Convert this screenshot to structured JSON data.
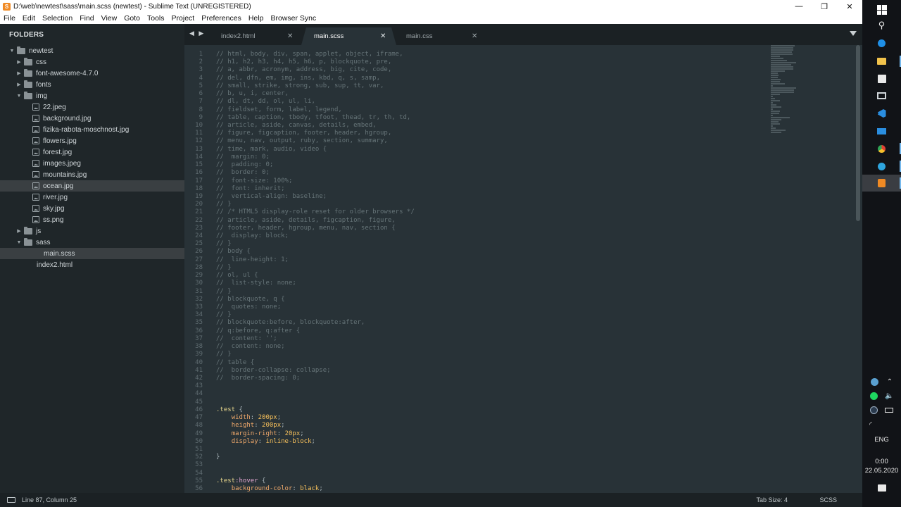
{
  "window": {
    "title": "D:\\web\\newtest\\sass\\main.scss (newtest) - Sublime Text (UNREGISTERED)",
    "minimize_glyph": "—",
    "restore_glyph": "❐",
    "close_glyph": "✕"
  },
  "menu": [
    "File",
    "Edit",
    "Selection",
    "Find",
    "View",
    "Goto",
    "Tools",
    "Project",
    "Preferences",
    "Help",
    "Browser Sync"
  ],
  "sidebar": {
    "header": "FOLDERS",
    "tree": [
      {
        "label": "newtest",
        "type": "folder",
        "open": true,
        "depth": 0
      },
      {
        "label": "css",
        "type": "folder",
        "open": false,
        "depth": 1
      },
      {
        "label": "font-awesome-4.7.0",
        "type": "folder",
        "open": false,
        "depth": 1
      },
      {
        "label": "fonts",
        "type": "folder",
        "open": false,
        "depth": 1
      },
      {
        "label": "img",
        "type": "folder",
        "open": true,
        "depth": 1
      },
      {
        "label": "22.jpeg",
        "type": "image",
        "depth": 2
      },
      {
        "label": "background.jpg",
        "type": "image",
        "depth": 2
      },
      {
        "label": "fizika-rabota-moschnost.jpg",
        "type": "image",
        "depth": 2
      },
      {
        "label": "flowers.jpg",
        "type": "image",
        "depth": 2
      },
      {
        "label": "forest.jpg",
        "type": "image",
        "depth": 2
      },
      {
        "label": "images.jpeg",
        "type": "image",
        "depth": 2
      },
      {
        "label": "mountains.jpg",
        "type": "image",
        "depth": 2
      },
      {
        "label": "ocean.jpg",
        "type": "image",
        "depth": 2,
        "hover": true
      },
      {
        "label": "river.jpg",
        "type": "image",
        "depth": 2
      },
      {
        "label": "sky.jpg",
        "type": "image",
        "depth": 2
      },
      {
        "label": "ss.png",
        "type": "image",
        "depth": 2
      },
      {
        "label": "js",
        "type": "folder",
        "open": false,
        "depth": 1
      },
      {
        "label": "sass",
        "type": "folder",
        "open": true,
        "depth": 1
      },
      {
        "label": "main.scss",
        "type": "file",
        "depth": 2,
        "active": true
      },
      {
        "label": "index2.html",
        "type": "file",
        "depth": 1
      }
    ]
  },
  "tabs": {
    "nav_glyph": "◀ ▶",
    "items": [
      {
        "label": "index2.html",
        "active": false
      },
      {
        "label": "main.scss",
        "active": true
      },
      {
        "label": "main.css",
        "active": false
      }
    ],
    "close_glyph": "✕"
  },
  "editor": {
    "lines": [
      [
        [
          "c",
          "// html, body, div, span, applet, object, iframe,"
        ]
      ],
      [
        [
          "c",
          "// h1, h2, h3, h4, h5, h6, p, blockquote, pre,"
        ]
      ],
      [
        [
          "c",
          "// a, abbr, acronym, address, big, cite, code,"
        ]
      ],
      [
        [
          "c",
          "// del, dfn, em, img, ins, kbd, q, s, samp,"
        ]
      ],
      [
        [
          "c",
          "// small, strike, strong, sub, sup, tt, var,"
        ]
      ],
      [
        [
          "c",
          "// b, u, i, center,"
        ]
      ],
      [
        [
          "c",
          "// dl, dt, dd, ol, ul, li,"
        ]
      ],
      [
        [
          "c",
          "// fieldset, form, label, legend,"
        ]
      ],
      [
        [
          "c",
          "// table, caption, tbody, tfoot, thead, tr, th, td,"
        ]
      ],
      [
        [
          "c",
          "// article, aside, canvas, details, embed,"
        ]
      ],
      [
        [
          "c",
          "// figure, figcaption, footer, header, hgroup,"
        ]
      ],
      [
        [
          "c",
          "// menu, nav, output, ruby, section, summary,"
        ]
      ],
      [
        [
          "c",
          "// time, mark, audio, video {"
        ]
      ],
      [
        [
          "c",
          "//  margin: 0;"
        ]
      ],
      [
        [
          "c",
          "//  padding: 0;"
        ]
      ],
      [
        [
          "c",
          "//  border: 0;"
        ]
      ],
      [
        [
          "c",
          "//  font-size: 100%;"
        ]
      ],
      [
        [
          "c",
          "//  font: inherit;"
        ]
      ],
      [
        [
          "c",
          "//  vertical-align: baseline;"
        ]
      ],
      [
        [
          "c",
          "// }"
        ]
      ],
      [
        [
          "c",
          "// /* HTML5 display-role reset for older browsers */"
        ]
      ],
      [
        [
          "c",
          "// article, aside, details, figcaption, figure,"
        ]
      ],
      [
        [
          "c",
          "// footer, header, hgroup, menu, nav, section {"
        ]
      ],
      [
        [
          "c",
          "//  display: block;"
        ]
      ],
      [
        [
          "c",
          "// }"
        ]
      ],
      [
        [
          "c",
          "// body {"
        ]
      ],
      [
        [
          "c",
          "//  line-height: 1;"
        ]
      ],
      [
        [
          "c",
          "// }"
        ]
      ],
      [
        [
          "c",
          "// ol, ul {"
        ]
      ],
      [
        [
          "c",
          "//  list-style: none;"
        ]
      ],
      [
        [
          "c",
          "// }"
        ]
      ],
      [
        [
          "c",
          "// blockquote, q {"
        ]
      ],
      [
        [
          "c",
          "//  quotes: none;"
        ]
      ],
      [
        [
          "c",
          "// }"
        ]
      ],
      [
        [
          "c",
          "// blockquote:before, blockquote:after,"
        ]
      ],
      [
        [
          "c",
          "// q:before, q:after {"
        ]
      ],
      [
        [
          "c",
          "//  content: '';"
        ]
      ],
      [
        [
          "c",
          "//  content: none;"
        ]
      ],
      [
        [
          "c",
          "// }"
        ]
      ],
      [
        [
          "c",
          "// table {"
        ]
      ],
      [
        [
          "c",
          "//  border-collapse: collapse;"
        ]
      ],
      [
        [
          "c",
          "//  border-spacing: 0;"
        ]
      ],
      [],
      [],
      [],
      [
        [
          "sel",
          ".test"
        ],
        [
          "punc",
          " {"
        ]
      ],
      [
        [
          "punc",
          "    "
        ],
        [
          "prop",
          "width"
        ],
        [
          "punc",
          ": "
        ],
        [
          "val",
          "200px"
        ],
        [
          "punc",
          ";"
        ]
      ],
      [
        [
          "punc",
          "    "
        ],
        [
          "prop",
          "height"
        ],
        [
          "punc",
          ": "
        ],
        [
          "val",
          "200px"
        ],
        [
          "punc",
          ";"
        ]
      ],
      [
        [
          "punc",
          "    "
        ],
        [
          "prop",
          "margin-right"
        ],
        [
          "punc",
          ": "
        ],
        [
          "val",
          "20px"
        ],
        [
          "punc",
          ";"
        ]
      ],
      [
        [
          "punc",
          "    "
        ],
        [
          "prop",
          "display"
        ],
        [
          "punc",
          ": "
        ],
        [
          "val",
          "inline-block"
        ],
        [
          "punc",
          ";"
        ]
      ],
      [],
      [
        [
          "punc",
          "}"
        ]
      ],
      [],
      [],
      [
        [
          "sel",
          ".test"
        ],
        [
          "kw",
          ":hover"
        ],
        [
          "punc",
          " {"
        ]
      ],
      [
        [
          "punc",
          "    "
        ],
        [
          "prop",
          "background-color"
        ],
        [
          "punc",
          ": "
        ],
        [
          "val",
          "black"
        ],
        [
          "punc",
          ";"
        ]
      ]
    ]
  },
  "status": {
    "position": "Line 87, Column 25",
    "tab_size": "Tab Size: 4",
    "syntax": "SCSS"
  },
  "taskbar": {
    "language": "ENG",
    "time": "0:00",
    "date": "22.05.2020"
  }
}
